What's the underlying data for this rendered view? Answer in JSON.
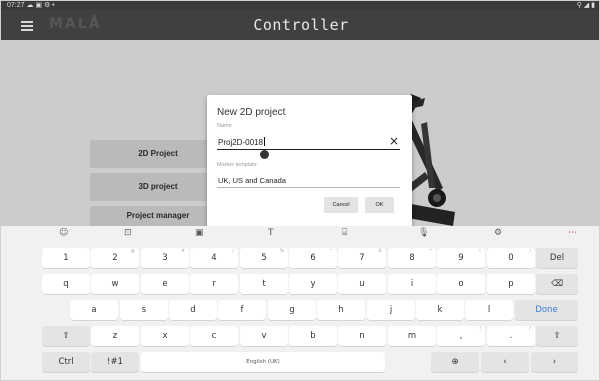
{
  "status_bar": {
    "time": "07:27 ☁ ▣ ⚙ •",
    "right_icons": "⚲ ◢ ▮"
  },
  "app_bar": {
    "brand": "MALÅ",
    "title": "Controller"
  },
  "main": {
    "buttons": [
      {
        "label": "2D Project"
      },
      {
        "label": "3D project"
      },
      {
        "label": "Project manager"
      }
    ]
  },
  "dialog": {
    "title": "New 2D project",
    "name_label": "Name",
    "name_value": "Proj2D-0018",
    "template_label": "Marker template",
    "template_value": "UK, US and Canada",
    "cancel_label": "Cancel",
    "ok_label": "OK"
  },
  "keyboard": {
    "toolbar": [
      "☺",
      "⊡",
      "▣",
      "T",
      "⌸",
      "🎙",
      "⚙",
      "⋯"
    ],
    "rows": [
      {
        "keys": [
          {
            "label": "1",
            "hint": ""
          },
          {
            "label": "2",
            "hint": "@"
          },
          {
            "label": "3",
            "hint": "#"
          },
          {
            "label": "4",
            "hint": "/"
          },
          {
            "label": "5",
            "hint": "%"
          },
          {
            "label": "6",
            "hint": "^"
          },
          {
            "label": "7",
            "hint": "&"
          },
          {
            "label": "8",
            "hint": "*"
          },
          {
            "label": "9",
            "hint": "("
          },
          {
            "label": "0",
            "hint": ")"
          },
          {
            "label": "Del",
            "hint": ""
          }
        ]
      },
      {
        "keys": [
          {
            "label": "q",
            "hint": ""
          },
          {
            "label": "w",
            "hint": ""
          },
          {
            "label": "e",
            "hint": ""
          },
          {
            "label": "r",
            "hint": ""
          },
          {
            "label": "t",
            "hint": ""
          },
          {
            "label": "y",
            "hint": ""
          },
          {
            "label": "u",
            "hint": ""
          },
          {
            "label": "i",
            "hint": ""
          },
          {
            "label": "o",
            "hint": ""
          },
          {
            "label": "p",
            "hint": ""
          },
          {
            "label": "⌫",
            "hint": ""
          }
        ]
      },
      {
        "keys": [
          {
            "label": "a",
            "hint": ""
          },
          {
            "label": "s",
            "hint": ""
          },
          {
            "label": "d",
            "hint": ""
          },
          {
            "label": "f",
            "hint": ""
          },
          {
            "label": "g",
            "hint": ""
          },
          {
            "label": "h",
            "hint": ""
          },
          {
            "label": "j",
            "hint": ""
          },
          {
            "label": "k",
            "hint": ""
          },
          {
            "label": "l",
            "hint": ""
          },
          {
            "label": "Done",
            "hint": ""
          }
        ]
      },
      {
        "keys": [
          {
            "label": "⇧",
            "hint": ""
          },
          {
            "label": "z",
            "hint": ""
          },
          {
            "label": "x",
            "hint": ""
          },
          {
            "label": "c",
            "hint": ""
          },
          {
            "label": "v",
            "hint": ""
          },
          {
            "label": "b",
            "hint": ""
          },
          {
            "label": "n",
            "hint": ""
          },
          {
            "label": "m",
            "hint": ""
          },
          {
            "label": ",",
            "hint": "!"
          },
          {
            "label": ".",
            "hint": "?"
          },
          {
            "label": "⇧",
            "hint": ""
          }
        ]
      },
      {
        "keys": [
          {
            "label": "Ctrl",
            "hint": ""
          },
          {
            "label": "!#1",
            "hint": ""
          },
          {
            "label": "English (UK)",
            "hint": ""
          },
          {
            "label": "⊕",
            "hint": ""
          },
          {
            "label": "‹",
            "hint": ""
          },
          {
            "label": "›",
            "hint": ""
          }
        ]
      }
    ]
  }
}
